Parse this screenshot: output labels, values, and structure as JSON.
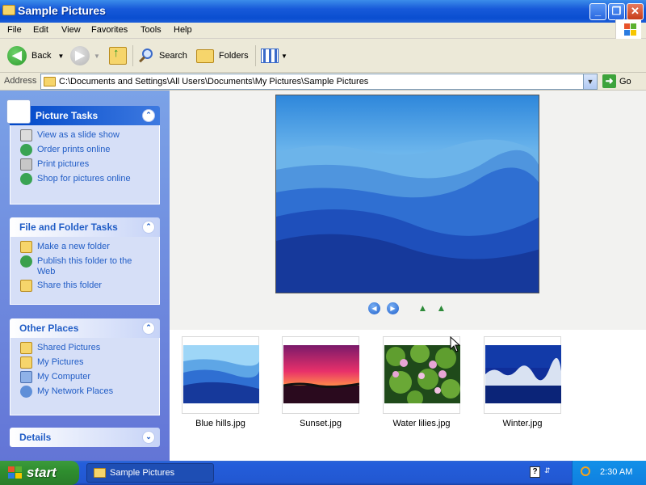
{
  "window": {
    "title": "Sample Pictures",
    "min_label": "_",
    "max_label": "❐",
    "close_label": "✕"
  },
  "menu": {
    "items": [
      {
        "label": "File"
      },
      {
        "label": "Edit"
      },
      {
        "label": "View"
      },
      {
        "label": "Favorites"
      },
      {
        "label": "Tools"
      },
      {
        "label": "Help"
      }
    ]
  },
  "toolbar": {
    "back_label": "Back",
    "search_label": "Search",
    "folders_label": "Folders",
    "back_icon": "back-arrow-icon",
    "forward_icon": "forward-arrow-icon",
    "up_icon": "up-folder-icon",
    "views_icon": "views-icon"
  },
  "address": {
    "label": "Address",
    "value": "C:\\Documents and Settings\\All Users\\Documents\\My Pictures\\Sample Pictures",
    "go_label": "Go"
  },
  "left_pane": {
    "picture_tasks": {
      "title": "Picture Tasks",
      "items": [
        {
          "label": "View as a slide show",
          "icon": "slideshow-icon"
        },
        {
          "label": "Order prints online",
          "icon": "order-prints-icon"
        },
        {
          "label": "Print pictures",
          "icon": "printer-icon"
        },
        {
          "label": "Shop for pictures online",
          "icon": "shop-icon"
        }
      ]
    },
    "file_folder_tasks": {
      "title": "File and Folder Tasks",
      "items": [
        {
          "label": "Make a new folder",
          "icon": "new-folder-icon"
        },
        {
          "label": "Publish this folder to the Web",
          "icon": "publish-web-icon"
        },
        {
          "label": "Share this folder",
          "icon": "share-folder-icon"
        }
      ]
    },
    "other_places": {
      "title": "Other Places",
      "items": [
        {
          "label": "Shared Pictures",
          "icon": "shared-pictures-icon"
        },
        {
          "label": "My Pictures",
          "icon": "my-pictures-icon"
        },
        {
          "label": "My Computer",
          "icon": "my-computer-icon"
        },
        {
          "label": "My Network Places",
          "icon": "network-places-icon"
        }
      ]
    },
    "details": {
      "title": "Details"
    }
  },
  "thumbnails": [
    {
      "name": "Blue hills.jpg"
    },
    {
      "name": "Sunset.jpg"
    },
    {
      "name": "Water lilies.jpg"
    },
    {
      "name": "Winter.jpg"
    }
  ],
  "taskbar": {
    "start_label": "start",
    "task_button_label": "Sample Pictures",
    "clock": "2:30 AM"
  },
  "colors": {
    "titlebar": "#0a4ed0",
    "left_pane": "#6f8ee0",
    "task_link": "#215dc6",
    "start_green": "#2f8f2f"
  }
}
